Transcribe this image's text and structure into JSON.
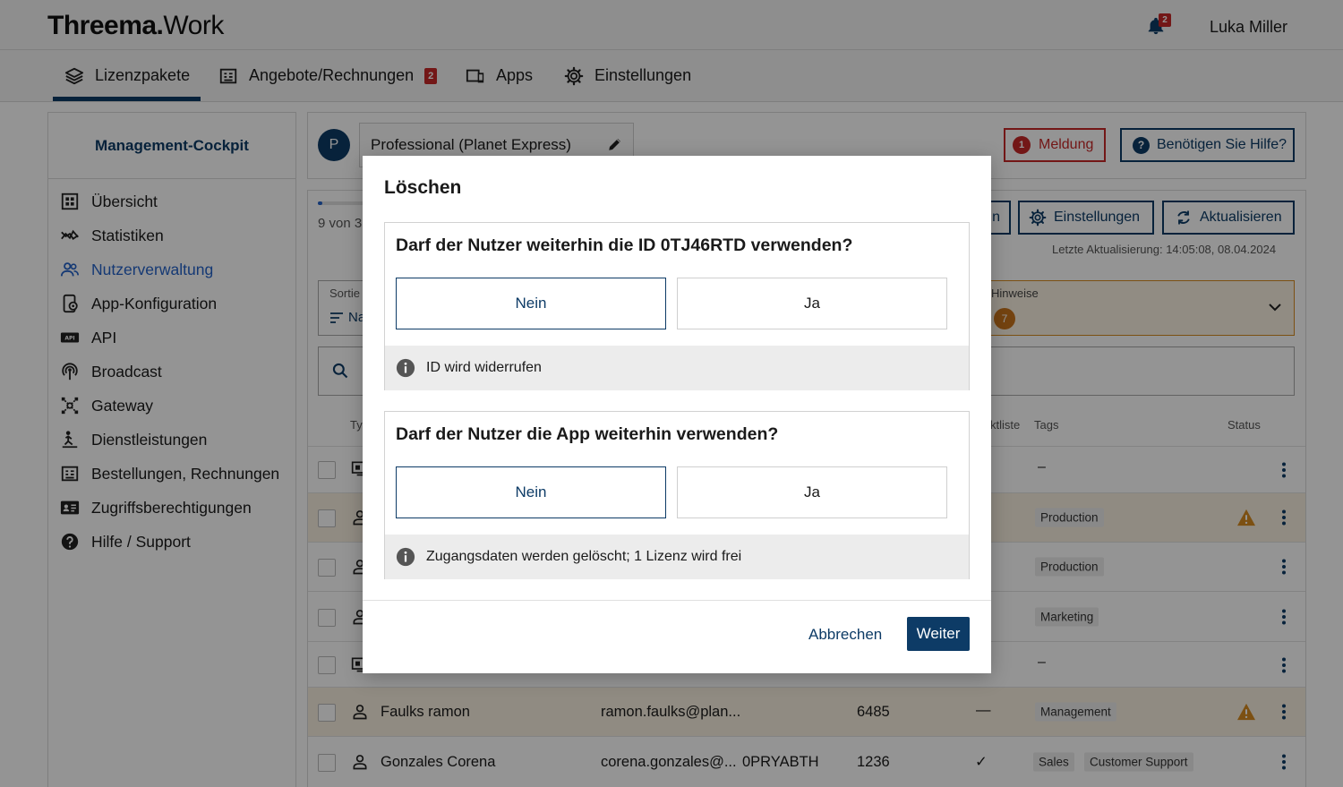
{
  "header": {
    "logo_bold": "Threema.",
    "logo_light": "Work",
    "notification_count": "2",
    "user_name": "Luka Miller"
  },
  "nav": {
    "tabs": [
      {
        "label": "Lizenzpakete",
        "icon": "layers-icon",
        "active": true
      },
      {
        "label": "Angebote/Rechnungen",
        "icon": "invoice-icon",
        "badge": "2"
      },
      {
        "label": "Apps",
        "icon": "devices-icon"
      },
      {
        "label": "Einstellungen",
        "icon": "gear-icon"
      }
    ]
  },
  "sidebar": {
    "title": "Management-Cockpit",
    "items": [
      {
        "label": "Übersicht",
        "icon": "grid-icon"
      },
      {
        "label": "Statistiken",
        "icon": "chart-icon"
      },
      {
        "label": "Nutzerverwaltung",
        "icon": "users-icon",
        "active": true
      },
      {
        "label": "App-Konfiguration",
        "icon": "app-config-icon"
      },
      {
        "label": "API",
        "icon": "api-icon"
      },
      {
        "label": "Broadcast",
        "icon": "broadcast-icon"
      },
      {
        "label": "Gateway",
        "icon": "gateway-icon"
      },
      {
        "label": "Dienstleistungen",
        "icon": "service-icon"
      },
      {
        "label": "Bestellungen, Rechnungen",
        "icon": "invoice-icon"
      },
      {
        "label": "Zugriffsberechtigungen",
        "icon": "id-card-icon"
      },
      {
        "label": "Hilfe / Support",
        "icon": "help-icon"
      }
    ]
  },
  "package": {
    "initial": "P",
    "name": "Professional (Planet Express)",
    "meldung_count": "1",
    "meldung_label": "Meldung",
    "help_label": "Benötigen Sie Hilfe?"
  },
  "toolbar": {
    "progress_fraction": 0.08,
    "count_text": "9 von 3",
    "partial_button_label": "n",
    "settings_label": "Einstellungen",
    "refresh_label": "Aktualisieren",
    "last_update": "Letzte Aktualisierung: 14:05:08, 08.04.2024"
  },
  "filters": {
    "sort_label": "Sortie",
    "sort_value": "Na",
    "hinweise_label": "Hinweise",
    "hinweise_count": "7"
  },
  "table": {
    "columns": {
      "type": "Ty",
      "checklist": "ktliste",
      "tags": "Tags",
      "status": "Status"
    },
    "rows": [
      {
        "kind": "device",
        "name": "",
        "email": "",
        "id": "",
        "num": "",
        "check": "",
        "tags": [],
        "tags_dash": "–",
        "warn": false
      },
      {
        "kind": "user",
        "name": "",
        "email": "",
        "id": "",
        "num": "",
        "check": "",
        "tags": [
          "Production"
        ],
        "warn": true
      },
      {
        "kind": "user",
        "name": "",
        "email": "",
        "id": "",
        "num": "",
        "check": "",
        "tags": [
          "Production"
        ],
        "warn": false
      },
      {
        "kind": "user",
        "name": "",
        "email": "",
        "id": "",
        "num": "",
        "check": "",
        "tags": [
          "Marketing"
        ],
        "warn": false
      },
      {
        "kind": "device",
        "name": "",
        "email": "",
        "id": "",
        "num": "",
        "check": "",
        "tags": [],
        "tags_dash": "–",
        "warn": false
      },
      {
        "kind": "user",
        "name": "Faulks ramon",
        "email": "ramon.faulks@plan...",
        "id": "",
        "num": "6485",
        "check": "—",
        "tags": [
          "Management"
        ],
        "warn": true
      },
      {
        "kind": "user",
        "name": "Gonzales Corena",
        "email": "corena.gonzales@...",
        "id": "0PRYABTH",
        "num": "1236",
        "check": "✓",
        "tags": [
          "Sales",
          "Customer Support"
        ],
        "warn": false
      }
    ]
  },
  "modal": {
    "title": "Löschen",
    "questions": [
      {
        "text": "Darf der Nutzer weiterhin die ID 0TJ46RTD verwenden?",
        "no": "Nein",
        "yes": "Ja",
        "selected": "no",
        "note": "ID wird widerrufen"
      },
      {
        "text": "Darf der Nutzer die App weiterhin verwenden?",
        "no": "Nein",
        "yes": "Ja",
        "selected": "no",
        "note": "Zugangsdaten werden gelöscht; 1 Lizenz wird frei"
      }
    ],
    "cancel_label": "Abbrechen",
    "next_label": "Weiter"
  }
}
